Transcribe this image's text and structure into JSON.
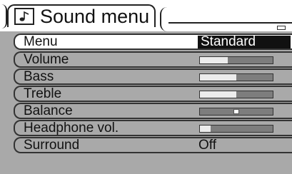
{
  "header": {
    "title": "Sound menu",
    "icon": "music-note-icon"
  },
  "rows": [
    {
      "label": "Menu",
      "value": "Standard",
      "kind": "selected-value"
    },
    {
      "label": "Volume",
      "level": 0.38,
      "kind": "bar"
    },
    {
      "label": "Bass",
      "level": 0.5,
      "kind": "bar"
    },
    {
      "label": "Treble",
      "level": 0.5,
      "kind": "bar"
    },
    {
      "label": "Balance",
      "level": 0.5,
      "kind": "balance"
    },
    {
      "label": "Headphone vol.",
      "level": 0.15,
      "kind": "bar"
    },
    {
      "label": "Surround",
      "value": "Off",
      "kind": "value"
    }
  ],
  "colors": {
    "panel": "#a9a9a9",
    "bar_fill": "#ececec",
    "bar_empty": "#7d7d7d",
    "selected_value_bg": "#111111"
  }
}
